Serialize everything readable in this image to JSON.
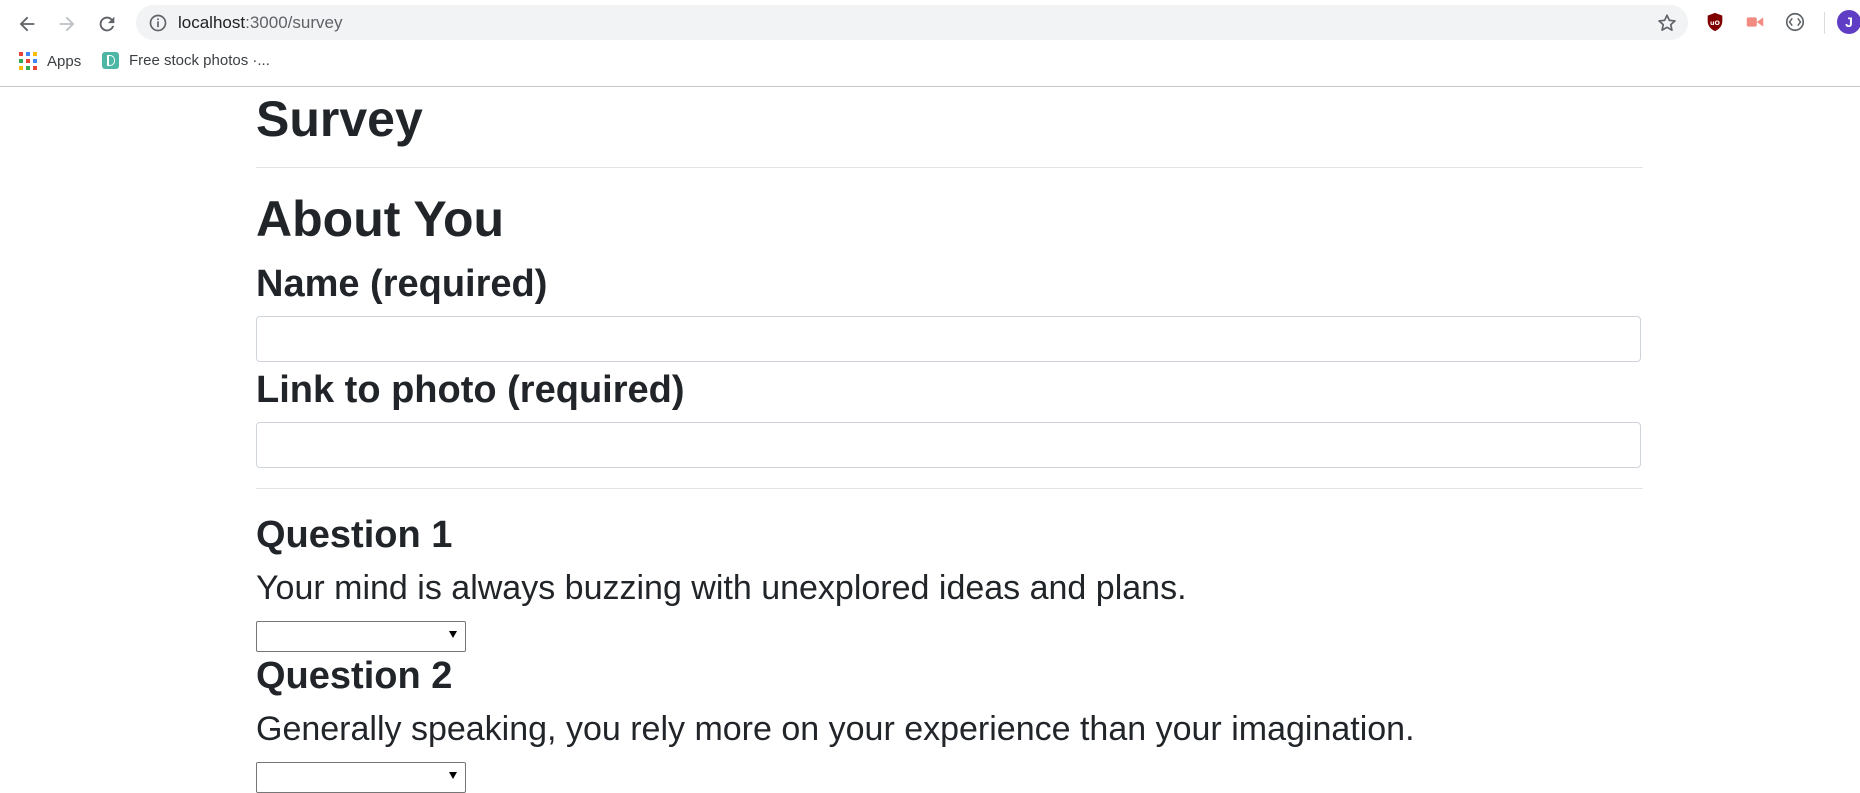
{
  "browser": {
    "url_host": "localhost",
    "url_path": ":3000/survey",
    "bookmarks": [
      {
        "label": "Apps",
        "icon": "apps-grid-icon"
      },
      {
        "label": "Free stock photos ·...",
        "icon": "site-favicon-icon"
      }
    ],
    "profile_initial": "J",
    "extensions": [
      "ublock-icon",
      "video-extension-icon",
      "code-extension-icon"
    ]
  },
  "page": {
    "title": "Survey",
    "section_title": "About You",
    "name_label": "Name (required)",
    "name_value": "",
    "photo_label": "Link to photo (required)",
    "photo_value": "",
    "questions": [
      {
        "heading": "Question 1",
        "text": "Your mind is always buzzing with unexplored ideas and plans.",
        "selected": ""
      },
      {
        "heading": "Question 2",
        "text": "Generally speaking, you rely more on your experience than your imagination.",
        "selected": ""
      }
    ]
  },
  "colors": {
    "text": "#212529",
    "divider": "#e3e3e3",
    "omnibox_bg": "#f1f3f4",
    "avatar": "#5f3dc4"
  }
}
